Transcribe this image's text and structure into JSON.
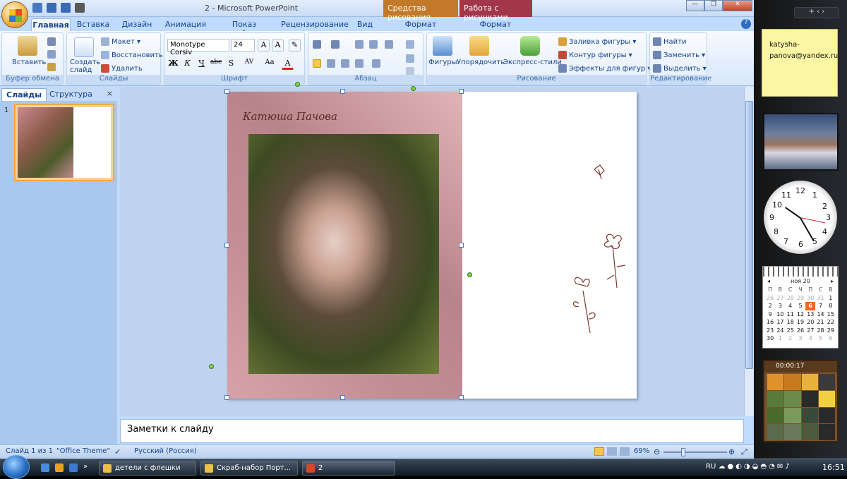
{
  "window": {
    "title": "2 - Microsoft PowerPoint",
    "context_tabs": [
      "Средства рисования",
      "Работа с рисунками"
    ]
  },
  "tabs": [
    "Главная",
    "Вставка",
    "Дизайн",
    "Анимация",
    "Показ слайдов",
    "Рецензирование",
    "Вид",
    "Формат",
    "Формат"
  ],
  "ribbon": {
    "clipboard": {
      "label": "Буфер обмена",
      "paste": "Вставить"
    },
    "slides": {
      "label": "Слайды",
      "new_slide": "Создать слайд",
      "layout": "Макет",
      "reset": "Восстановить",
      "delete": "Удалить"
    },
    "font": {
      "label": "Шрифт",
      "family": "Monotype Corsiv",
      "size": "24",
      "bold": "Ж",
      "italic": "К",
      "underline": "Ч",
      "strike": "abc",
      "shadow": "S",
      "spacing": "AV",
      "case": "Aa",
      "color": "A"
    },
    "paragraph": {
      "label": "Абзац"
    },
    "drawing": {
      "label": "Рисование",
      "shapes": "Фигуры",
      "arrange": "Упорядочить",
      "quick_styles": "Экспресс-стили",
      "fill": "Заливка фигуры",
      "outline": "Контур фигуры",
      "effects": "Эффекты для фигур"
    },
    "editing": {
      "label": "Редактирование",
      "find": "Найти",
      "replace": "Заменить",
      "select": "Выделить"
    }
  },
  "left_pane": {
    "tab_slides": "Слайды",
    "tab_outline": "Структура",
    "close": "×",
    "slide_number": "1"
  },
  "slide": {
    "title_text": "Катюша Пачова"
  },
  "notes": {
    "placeholder": "Заметки к слайду"
  },
  "status": {
    "slide_info": "Слайд 1 из 1",
    "theme": "\"Office Theme\"",
    "language": "Русский (Россия)",
    "zoom": "69%"
  },
  "sidebar": {
    "sticky_note": "katysha-panova@yandex.ru",
    "calendar": {
      "month": "ноя 20",
      "weekdays": [
        "П",
        "В",
        "С",
        "Ч",
        "П",
        "С",
        "В"
      ],
      "days": [
        "26",
        "27",
        "28",
        "29",
        "30",
        "31",
        "1",
        "2",
        "3",
        "4",
        "5",
        "6",
        "7",
        "8",
        "9",
        "10",
        "11",
        "12",
        "13",
        "14",
        "15",
        "16",
        "17",
        "18",
        "19",
        "20",
        "21",
        "22",
        "23",
        "24",
        "25",
        "26",
        "27",
        "28",
        "29",
        "30",
        "1",
        "2",
        "3",
        "4",
        "5",
        "6"
      ],
      "today": "6"
    },
    "clock_numbers": [
      "12",
      "1",
      "2",
      "3",
      "4",
      "5",
      "6",
      "7",
      "8",
      "9",
      "10",
      "11"
    ],
    "puzzle_timer": "00:00:17"
  },
  "taskbar": {
    "items": [
      "детели с флешки",
      "Скраб-набор Порт...",
      "2"
    ],
    "lang": "RU",
    "time": "16:51"
  },
  "colors": {
    "ribbon_text": "#15428b",
    "context_draw": "#c27a2a",
    "context_pic": "#a2364a",
    "today": "#e96b22"
  }
}
